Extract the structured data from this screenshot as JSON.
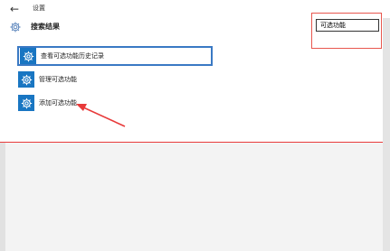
{
  "window": {
    "title": "设置",
    "back_glyph": "←"
  },
  "header": {
    "title": "搜索结果",
    "icon": "gear-icon"
  },
  "search": {
    "value": "可选功能"
  },
  "results": [
    {
      "label": "查看可选功能历史记录",
      "icon": "gear-icon",
      "selected": true
    },
    {
      "label": "管理可选功能",
      "icon": "gear-icon",
      "selected": false
    },
    {
      "label": "添加可选功能",
      "icon": "gear-icon",
      "selected": false
    }
  ],
  "colors": {
    "accent": "#1976c2",
    "selection_border": "#3a79c4",
    "annotation_red": "#e83a3a"
  }
}
